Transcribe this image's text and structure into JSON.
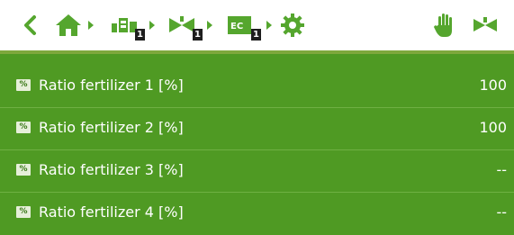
{
  "header": {
    "back_icon": "chevron-left-icon",
    "breadcrumbs": [
      {
        "name": "home",
        "icon": "home-icon"
      },
      {
        "name": "machine",
        "icon": "machine-icon",
        "badge": "1"
      },
      {
        "name": "fertilizer",
        "icon": "fertilizer-icon",
        "badge": "1"
      },
      {
        "name": "ec",
        "icon": "ec-icon",
        "text": "EC",
        "badge": "1"
      },
      {
        "name": "settings",
        "icon": "gear-icon"
      }
    ],
    "actions": [
      {
        "name": "manual-mode",
        "icon": "hand-icon"
      },
      {
        "name": "fertilizer",
        "icon": "fertilizer-icon"
      }
    ],
    "colors": {
      "icon": "#55a62e",
      "accent": "#7ea83c"
    }
  },
  "rows": [
    {
      "icon": "percent-icon",
      "icon_text": "%",
      "label": "Ratio fertilizer 1 [%]",
      "value": "100"
    },
    {
      "icon": "percent-icon",
      "icon_text": "%",
      "label": "Ratio fertilizer 2 [%]",
      "value": "100"
    },
    {
      "icon": "percent-icon",
      "icon_text": "%",
      "label": "Ratio fertilizer 3 [%]",
      "value": "--"
    },
    {
      "icon": "percent-icon",
      "icon_text": "%",
      "label": "Ratio fertilizer 4 [%]",
      "value": "--"
    }
  ],
  "list_colors": {
    "background": "#4f9a23",
    "text": "#ffffff"
  }
}
